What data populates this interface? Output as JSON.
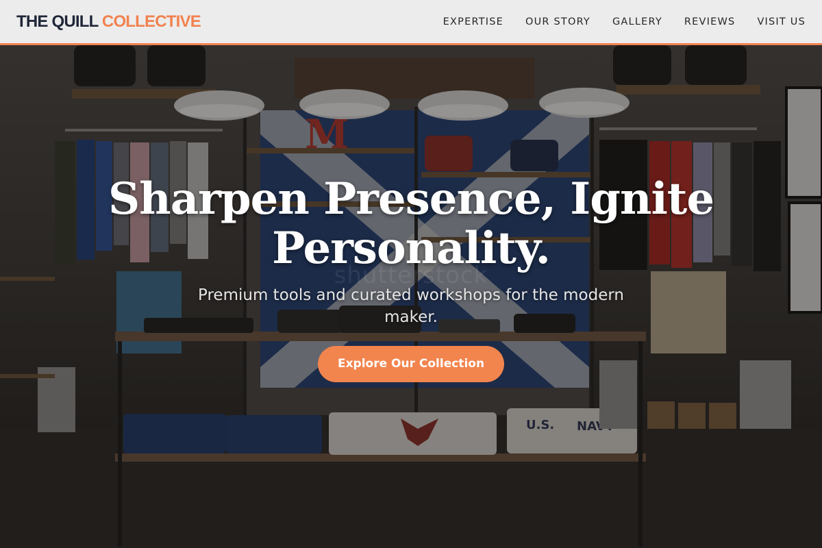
{
  "header": {
    "brand_primary": "THE QUILL",
    "brand_accent": "COLLECTIVE",
    "nav": [
      {
        "label": "EXPERTISE"
      },
      {
        "label": "OUR STORY"
      },
      {
        "label": "GALLERY"
      },
      {
        "label": "REVIEWS"
      },
      {
        "label": "VISIT US"
      }
    ]
  },
  "hero": {
    "headline_line1": "Sharpen Presence, Ignite",
    "headline_line2": "Personality.",
    "subheading": "Premium tools and curated workshops for the modern maker.",
    "cta_label": "Explore Our Collection",
    "watermark": "shutterstock"
  },
  "colors": {
    "accent": "#f2824f",
    "brand_dark": "#1f2638",
    "header_bg": "#ececec",
    "headline": "#ffffff"
  },
  "icons": [
    "store-interior-photo"
  ]
}
